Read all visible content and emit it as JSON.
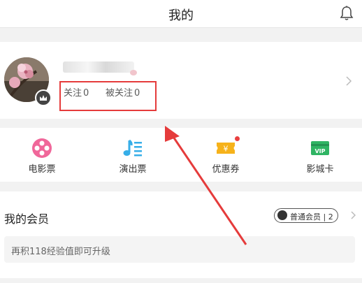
{
  "header": {
    "title": "我的",
    "icon": "bell-icon"
  },
  "profile": {
    "name_blurred": true,
    "following_label": "关注",
    "following_count": "0",
    "followers_label": "被关注",
    "followers_count": "0"
  },
  "menu": [
    {
      "label": "电影票",
      "icon": "movie-ticket-icon",
      "color": "#f0679a"
    },
    {
      "label": "演出票",
      "icon": "music-note-icon",
      "color": "#36aee8"
    },
    {
      "label": "优惠券",
      "icon": "coupon-icon",
      "color": "#f6b21a",
      "has_dot": true
    },
    {
      "label": "影城卡",
      "icon": "vip-card-icon",
      "color": "#2fb463",
      "card_text": "VIP"
    }
  ],
  "member": {
    "title": "我的会员",
    "level_name": "普通会员",
    "level_sep": "|",
    "level_num": "2",
    "progress_text": "再积118经验值即可升级"
  },
  "annotation_color": "#e53b3b"
}
